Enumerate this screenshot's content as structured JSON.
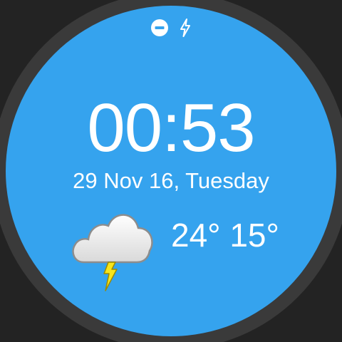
{
  "status_icons": [
    "do-not-disturb-icon",
    "charging-icon"
  ],
  "clock": {
    "time": "00:53",
    "date": "29 Nov 16, Tuesday"
  },
  "weather": {
    "condition_icon": "thunderstorm-cloud-icon",
    "high_temp": "24°",
    "low_temp": "15°"
  },
  "colors": {
    "face": "#35a3ee",
    "bezel": "#3a3a3a",
    "background": "#232323",
    "text": "#ffffff",
    "lightning": "#f7e51b"
  }
}
